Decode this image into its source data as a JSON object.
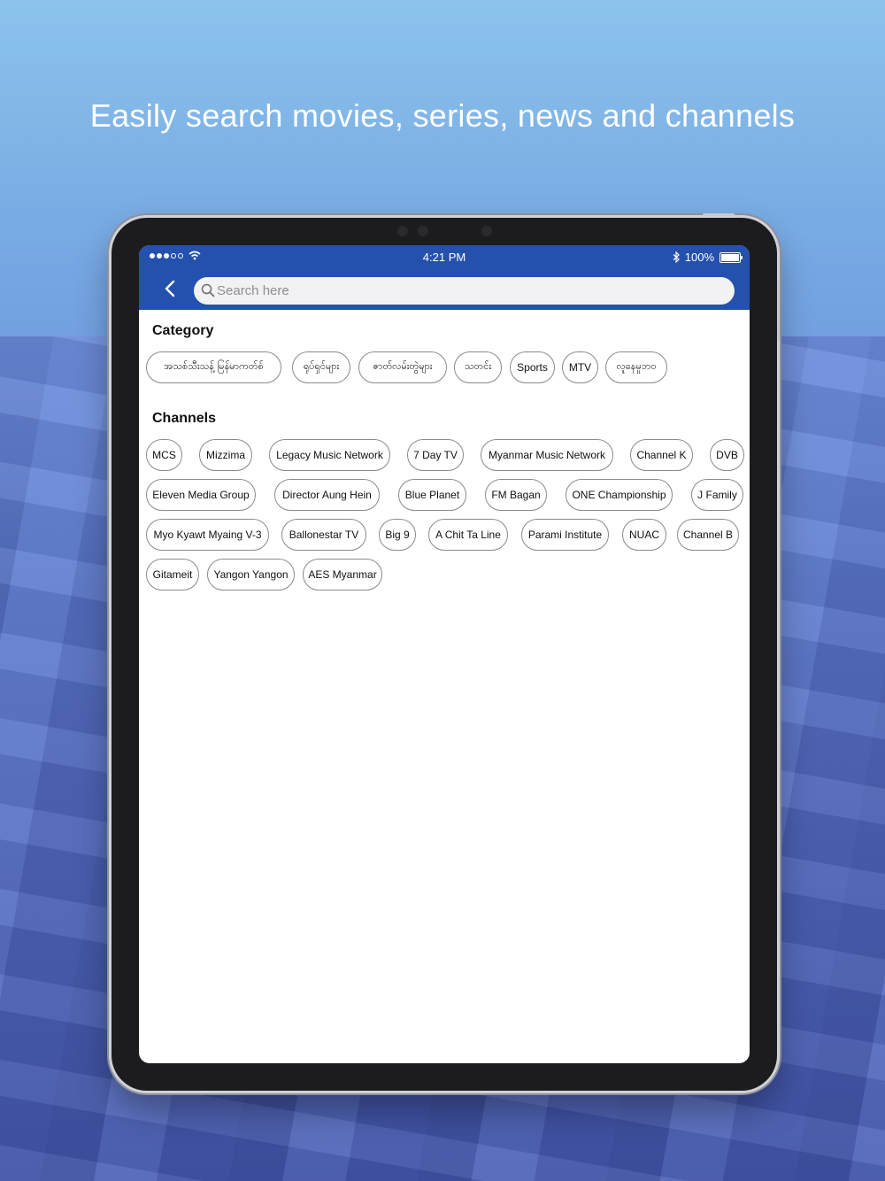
{
  "headline": "Easily search movies, series, news and channels",
  "status_bar": {
    "time": "4:21 PM",
    "battery": "100%",
    "signal_icon": "signal-dots-icon",
    "wifi_icon": "wifi-icon",
    "bluetooth_icon": "bluetooth-icon"
  },
  "search": {
    "placeholder": "Search here",
    "value": ""
  },
  "category": {
    "title": "Category",
    "items": [
      "အသစ်သီးသန့် မြန်မာကတ်စ်",
      "ရုပ်ရှင်များ",
      "ဇာတ်လမ်းတွဲများ",
      "သတင်း",
      "Sports",
      "MTV",
      "လူနေမှုဘဝ"
    ]
  },
  "channels": {
    "title": "Channels",
    "rows": [
      [
        "MCS",
        "Mizzima",
        "Legacy Music Network",
        "7 Day TV",
        "Myanmar Music Network",
        "Channel K",
        "DVB"
      ],
      [
        "Eleven Media Group",
        "Director Aung Hein",
        "Blue Planet",
        "FM Bagan",
        "ONE Championship",
        "J Family"
      ],
      [
        "Myo Kyawt Myaing V-3",
        "Ballonestar TV",
        "Big 9",
        "A Chit Ta Line",
        "Parami Institute",
        "NUAC",
        "Channel B"
      ],
      [
        "Gitameit",
        "Yangon Yangon",
        "AES Myanmar"
      ]
    ]
  },
  "colors": {
    "navbar": "#2451ad",
    "chip_border": "#8a8a8a"
  }
}
